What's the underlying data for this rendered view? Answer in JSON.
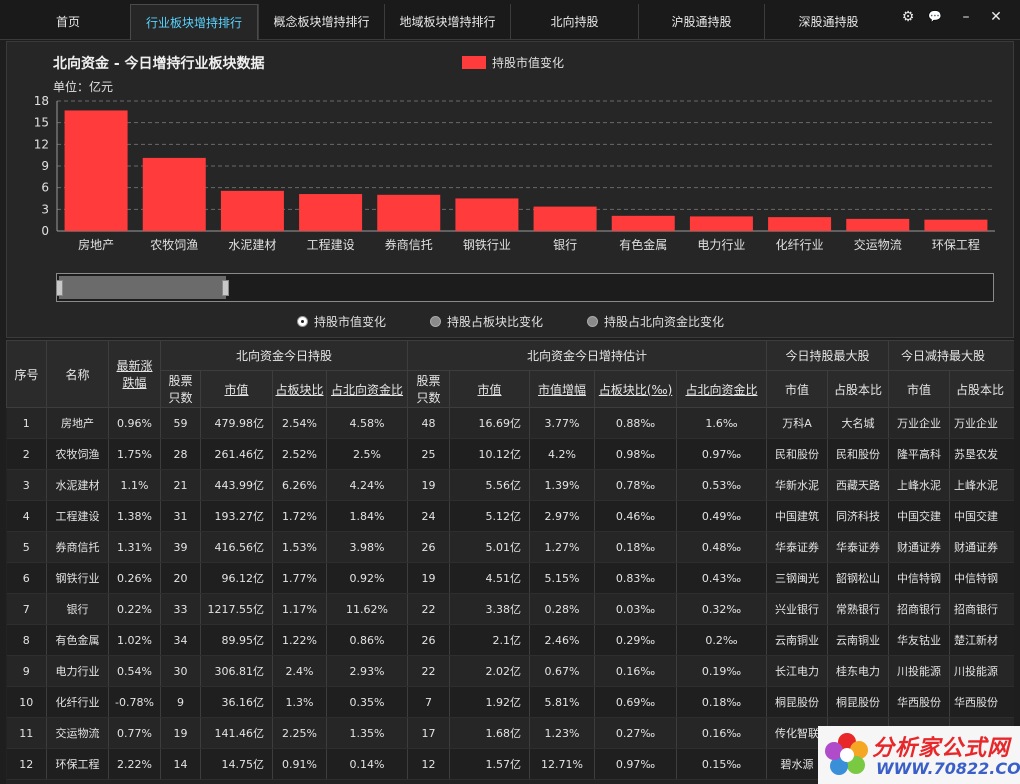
{
  "nav": {
    "tabs": [
      {
        "label": "首页"
      },
      {
        "label": "行业板块增持排行"
      },
      {
        "label": "概念板块增持排行"
      },
      {
        "label": "地域板块增持排行"
      },
      {
        "label": "北向持股"
      },
      {
        "label": "沪股通持股"
      },
      {
        "label": "深股通持股"
      }
    ],
    "active_index": 1
  },
  "window_controls": {
    "settings": "⚙",
    "chat": "💬",
    "minimize": "–",
    "close": "✕"
  },
  "chart_panel": {
    "title": "北向资金 - 今日增持行业板块数据",
    "unit": "单位：亿元",
    "legend_label": "持股市值变化",
    "bar_color": "#ff3b3b"
  },
  "chart_data": {
    "type": "bar",
    "categories": [
      "房地产",
      "农牧饲渔",
      "水泥建材",
      "工程建设",
      "券商信托",
      "钢铁行业",
      "银行",
      "有色金属",
      "电力行业",
      "化纤行业",
      "交运物流",
      "环保工程"
    ],
    "series": [
      {
        "name": "持股市值变化",
        "values": [
          16.69,
          10.12,
          5.56,
          5.12,
          5.01,
          4.51,
          3.38,
          2.1,
          2.02,
          1.92,
          1.68,
          1.57
        ]
      }
    ],
    "ylim": [
      0,
      18
    ],
    "yticks": [
      "0",
      "3",
      "6",
      "9",
      "12",
      "15",
      "18"
    ],
    "grid": true,
    "legend_position": "top"
  },
  "radios": [
    {
      "label": "持股市值变化",
      "checked": true
    },
    {
      "label": "持股占板块比变化",
      "checked": false
    },
    {
      "label": "持股占北向资金比变化",
      "checked": false
    }
  ],
  "table": {
    "group_headers": {
      "today_hold": "北向资金今日持股",
      "today_add": "北向资金今日增持估计",
      "top_hold": "今日持股最大股",
      "top_reduce": "今日减持最大股"
    },
    "headers": {
      "seq": "序号",
      "name": "名称",
      "latest_change": "最新涨跌幅",
      "stock_count": "股票只数",
      "market_value": "市值",
      "sector_ratio": "占板块比",
      "north_ratio": "占北向资金比",
      "add_stock_count": "股票只数",
      "add_market_value": "市值",
      "add_value_growth": "市值增幅",
      "add_sector_ratio": "占板块比(‰)",
      "add_north_ratio": "占北向资金比",
      "top_hold_value": "市值",
      "top_hold_ratio": "占股本比",
      "top_reduce_value": "市值",
      "top_reduce_ratio": "占股本比"
    },
    "rows": [
      [
        "1",
        "房地产",
        "0.96%",
        "59",
        "479.98亿",
        "2.54%",
        "4.58%",
        "48",
        "16.69亿",
        "3.77%",
        "0.88‰",
        "1.6‰",
        "万科A",
        "大名城",
        "万业企业",
        "万业企业"
      ],
      [
        "2",
        "农牧饲渔",
        "1.75%",
        "28",
        "261.46亿",
        "2.52%",
        "2.5%",
        "25",
        "10.12亿",
        "4.2%",
        "0.98‰",
        "0.97‰",
        "民和股份",
        "民和股份",
        "隆平高科",
        "苏垦农发"
      ],
      [
        "3",
        "水泥建材",
        "1.1%",
        "21",
        "443.99亿",
        "6.26%",
        "4.24%",
        "19",
        "5.56亿",
        "1.39%",
        "0.78‰",
        "0.53‰",
        "华新水泥",
        "西藏天路",
        "上峰水泥",
        "上峰水泥"
      ],
      [
        "4",
        "工程建设",
        "1.38%",
        "31",
        "193.27亿",
        "1.72%",
        "1.84%",
        "24",
        "5.12亿",
        "2.97%",
        "0.46‰",
        "0.49‰",
        "中国建筑",
        "同济科技",
        "中国交建",
        "中国交建"
      ],
      [
        "5",
        "券商信托",
        "1.31%",
        "39",
        "416.56亿",
        "1.53%",
        "3.98%",
        "26",
        "5.01亿",
        "1.27%",
        "0.18‰",
        "0.48‰",
        "华泰证券",
        "华泰证券",
        "财通证券",
        "财通证券"
      ],
      [
        "6",
        "钢铁行业",
        "0.26%",
        "20",
        "96.12亿",
        "1.77%",
        "0.92%",
        "19",
        "4.51亿",
        "5.15%",
        "0.83‰",
        "0.43‰",
        "三钢闽光",
        "韶钢松山",
        "中信特钢",
        "中信特钢"
      ],
      [
        "7",
        "银行",
        "0.22%",
        "33",
        "1217.55亿",
        "1.17%",
        "11.62%",
        "22",
        "3.38亿",
        "0.28%",
        "0.03‰",
        "0.32‰",
        "兴业银行",
        "常熟银行",
        "招商银行",
        "招商银行"
      ],
      [
        "8",
        "有色金属",
        "1.02%",
        "34",
        "89.95亿",
        "1.22%",
        "0.86%",
        "26",
        "2.1亿",
        "2.46%",
        "0.29‰",
        "0.2‰",
        "云南铜业",
        "云南铜业",
        "华友钴业",
        "楚江新材"
      ],
      [
        "9",
        "电力行业",
        "0.54%",
        "30",
        "306.81亿",
        "2.4%",
        "2.93%",
        "22",
        "2.02亿",
        "0.67%",
        "0.16‰",
        "0.19‰",
        "长江电力",
        "桂东电力",
        "川投能源",
        "川投能源"
      ],
      [
        "10",
        "化纤行业",
        "-0.78%",
        "9",
        "36.16亿",
        "1.3%",
        "0.35%",
        "7",
        "1.92亿",
        "5.81%",
        "0.69‰",
        "0.18‰",
        "桐昆股份",
        "桐昆股份",
        "华西股份",
        "华西股份"
      ],
      [
        "11",
        "交运物流",
        "0.77%",
        "19",
        "141.46亿",
        "2.25%",
        "1.35%",
        "17",
        "1.68亿",
        "1.23%",
        "0.27‰",
        "0.16‰",
        "传化智联",
        "",
        "",
        ""
      ],
      [
        "12",
        "环保工程",
        "2.22%",
        "14",
        "14.75亿",
        "0.91%",
        "0.14%",
        "12",
        "1.57亿",
        "12.71%",
        "0.97‰",
        "0.15‰",
        "碧水源",
        "",
        "",
        ""
      ]
    ]
  },
  "watermark": {
    "line1": "分析家公式网",
    "line2": "WWW.70822.COM"
  }
}
